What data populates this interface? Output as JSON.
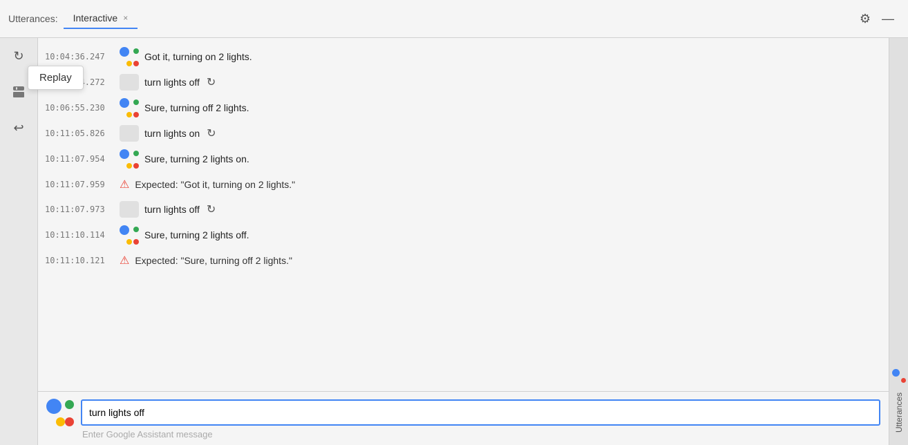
{
  "titlebar": {
    "label": "Utterances:",
    "tab_label": "Interactive",
    "tab_close": "×",
    "gear_icon": "⚙",
    "minus_icon": "—"
  },
  "tooltip": {
    "label": "Replay"
  },
  "sidebar_icons": {
    "replay_icon": "↻",
    "save_icon": "💾",
    "undo_icon": "↩"
  },
  "messages": [
    {
      "id": 1,
      "timestamp": "10:04:36.247",
      "type": "assistant",
      "text": "Got it, turning on 2 lights."
    },
    {
      "id": 2,
      "timestamp": "10:05:14.272",
      "type": "user",
      "text": "turn lights off"
    },
    {
      "id": 3,
      "timestamp": "10:06:55.230",
      "type": "assistant",
      "text": "Sure, turning off 2 lights."
    },
    {
      "id": 4,
      "timestamp": "10:11:05.826",
      "type": "user",
      "text": "turn lights on"
    },
    {
      "id": 5,
      "timestamp": "10:11:07.954",
      "type": "assistant",
      "text": "Sure, turning 2 lights on."
    },
    {
      "id": 6,
      "timestamp": "10:11:07.959",
      "type": "error",
      "text": "Expected: \"Got it, turning on 2 lights.\""
    },
    {
      "id": 7,
      "timestamp": "10:11:07.973",
      "type": "user",
      "text": "turn lights off"
    },
    {
      "id": 8,
      "timestamp": "10:11:10.114",
      "type": "assistant",
      "text": "Sure, turning 2 lights off."
    },
    {
      "id": 9,
      "timestamp": "10:11:10.121",
      "type": "error",
      "text": "Expected: \"Sure, turning off 2 lights.\""
    }
  ],
  "input": {
    "value": "turn lights off",
    "placeholder": "Enter Google Assistant message"
  },
  "right_sidebar": {
    "label": "Utterances"
  }
}
